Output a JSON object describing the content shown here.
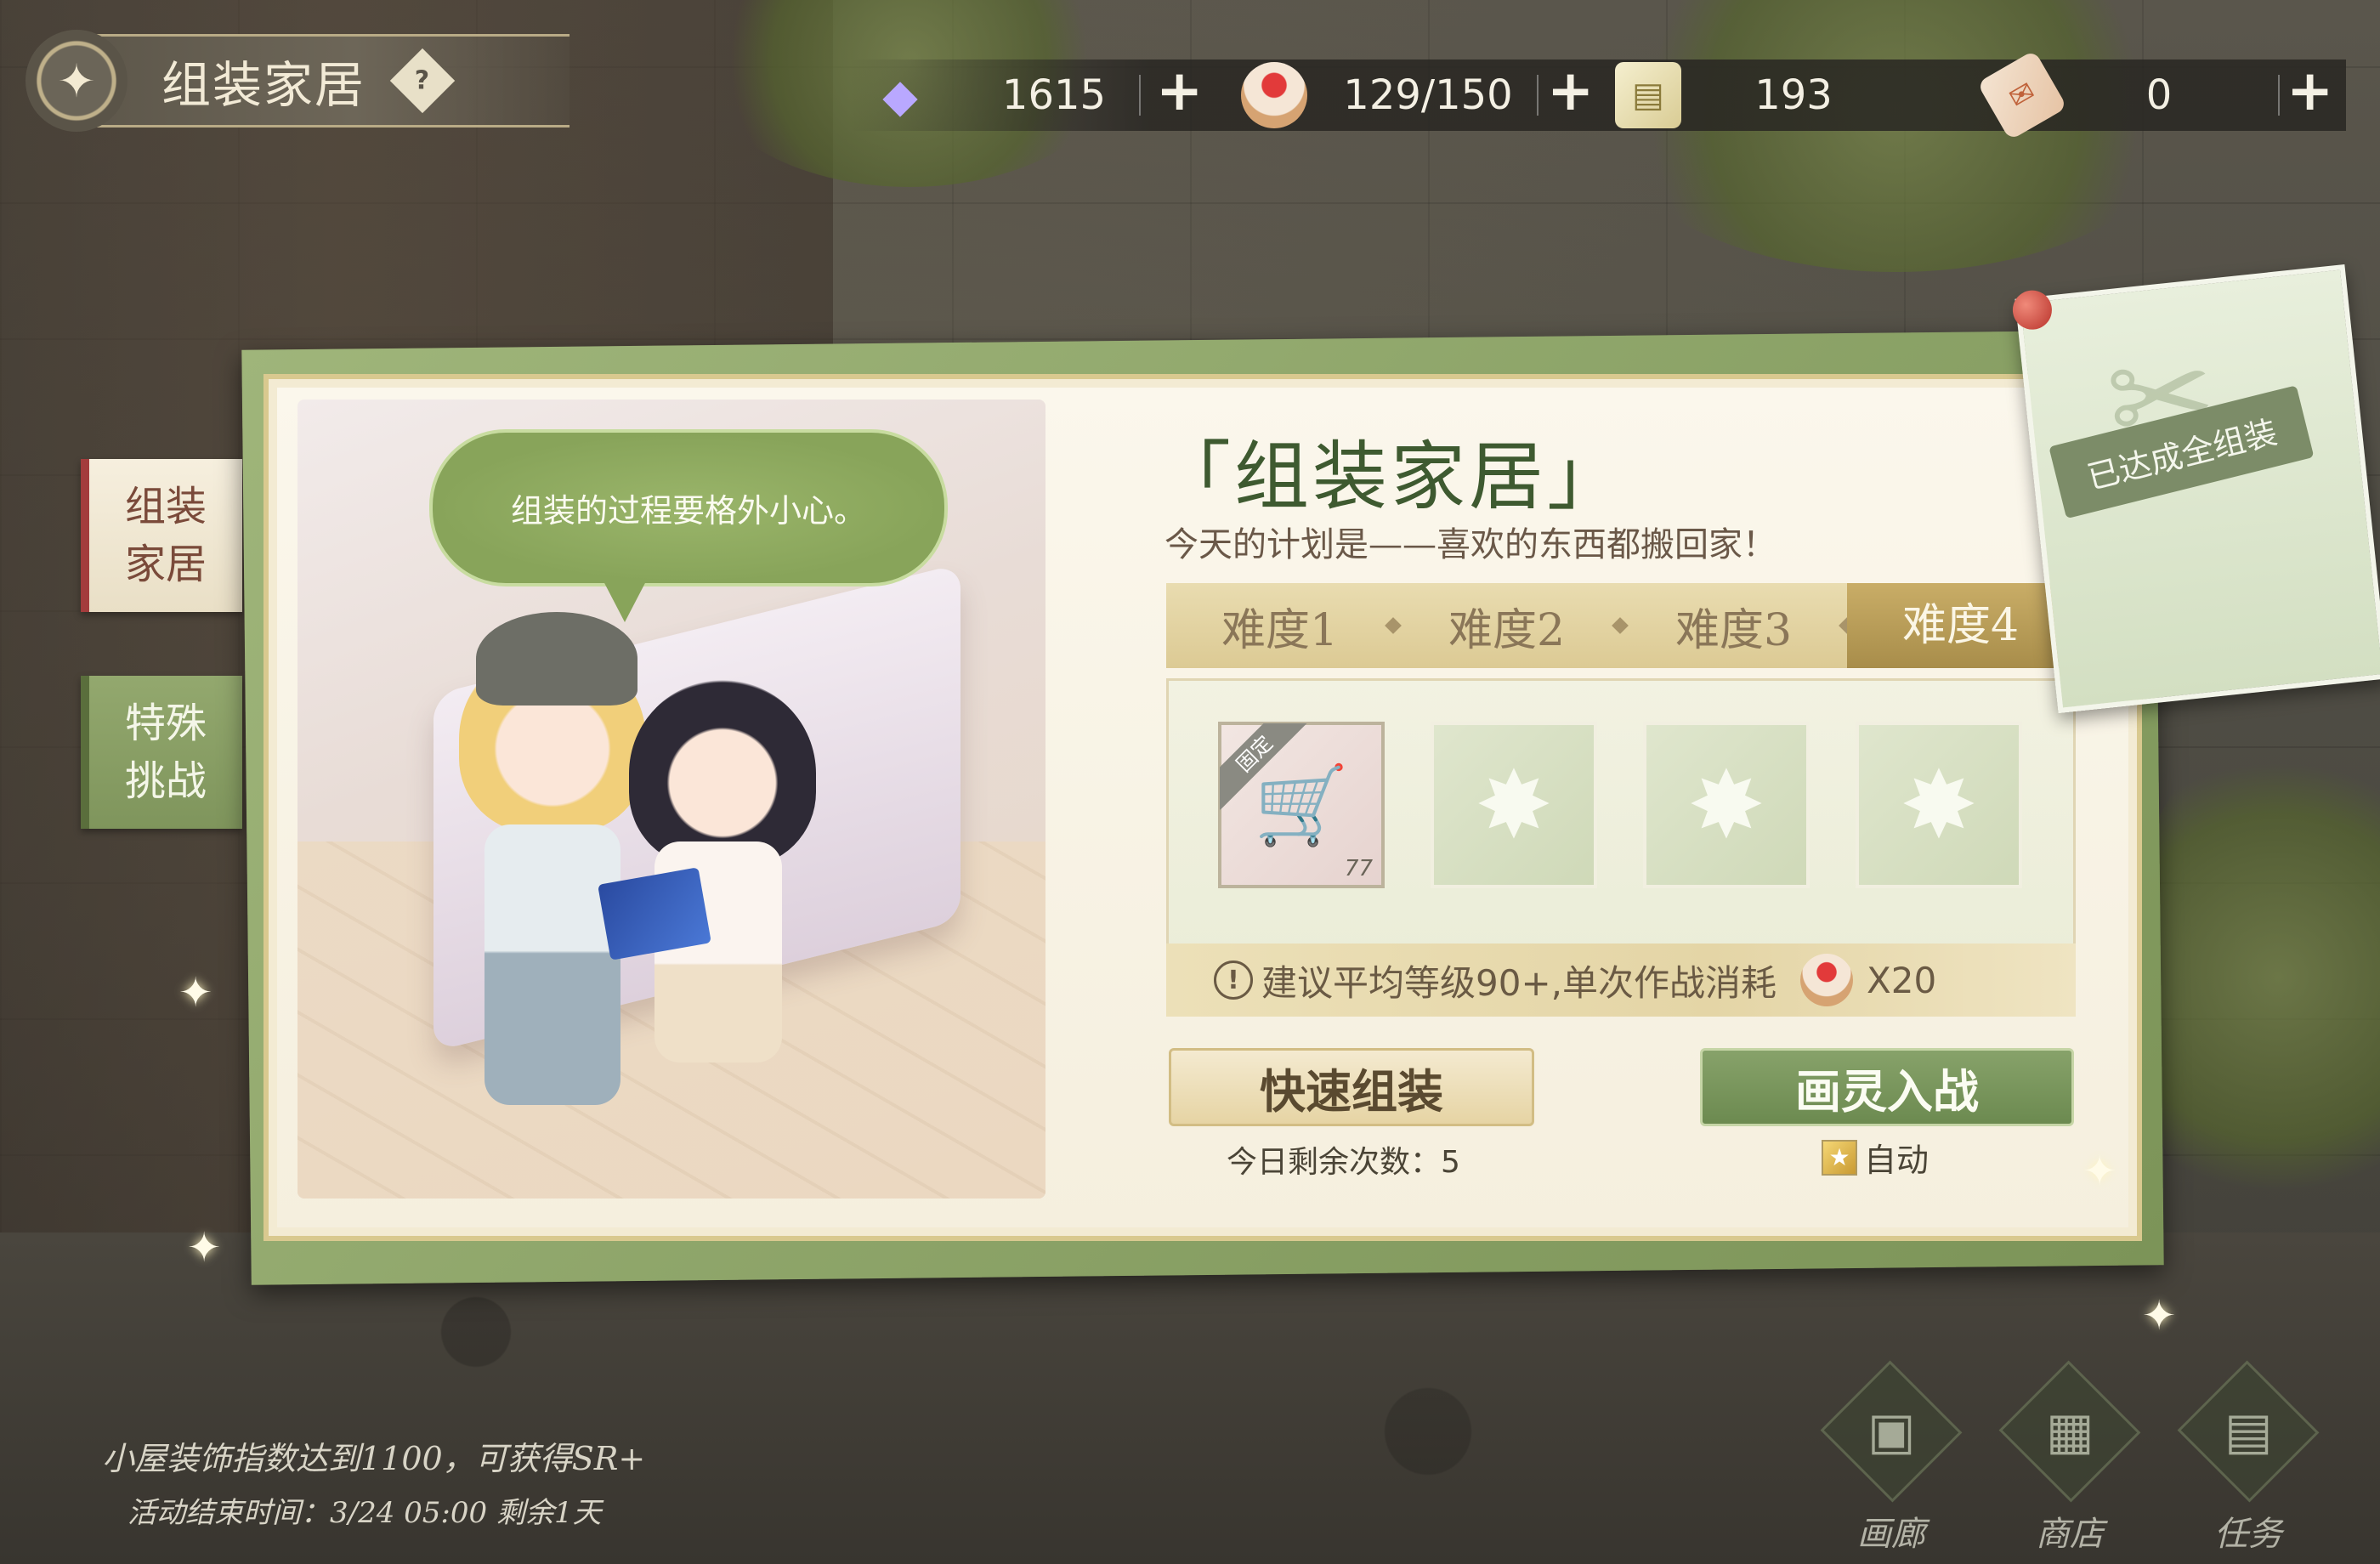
{
  "header": {
    "title": "组装家居",
    "help_label": "?"
  },
  "resources": [
    {
      "icon": "diamond-icon",
      "value": "1615",
      "plus": "+"
    },
    {
      "icon": "strawberry-cake-icon",
      "value": "129/150",
      "plus": "+"
    },
    {
      "icon": "blueprint-scroll-icon",
      "value": "193"
    },
    {
      "icon": "ticket-icon",
      "value": "0",
      "plus": "+"
    }
  ],
  "side_tabs": {
    "assemble": "组装家居",
    "special": "特殊挑战"
  },
  "scene": {
    "speech": "组装的过程要格外小心。"
  },
  "stage": {
    "title": "「组装家居」",
    "subtitle": "今天的计划是——喜欢的东西都搬回家！",
    "difficulties": [
      "难度1",
      "难度2",
      "难度3",
      "难度4"
    ],
    "active_difficulty_index": 3
  },
  "rewards": {
    "fixed_tag": "固定",
    "first_item_icon": "blueprint-cart-icon",
    "first_item_qty": "77",
    "empty_slot_icon": "star-burst-icon"
  },
  "hint": {
    "text": "建议平均等级90+,单次作战消耗",
    "cost": "X20"
  },
  "actions": {
    "quick_label": "快速组装",
    "remaining": "今日剩余次数：5",
    "battle_label": "画灵入战",
    "auto_label": "自动"
  },
  "completion_note": {
    "label": "已达成全组装"
  },
  "event_info": {
    "line1": "小屋装饰指数达到1100，可获得SR+",
    "line2": "活动结束时间：3/24  05:00  剩余1天"
  },
  "bottom_nav": [
    {
      "label": "画廊",
      "icon": "gallery-icon"
    },
    {
      "label": "商店",
      "icon": "shop-icon"
    },
    {
      "label": "任务",
      "icon": "task-icon"
    }
  ],
  "colors": {
    "accent_green": "#6c8a50",
    "accent_gold": "#c9ad67",
    "panel_bg": "#fbf7ec"
  }
}
